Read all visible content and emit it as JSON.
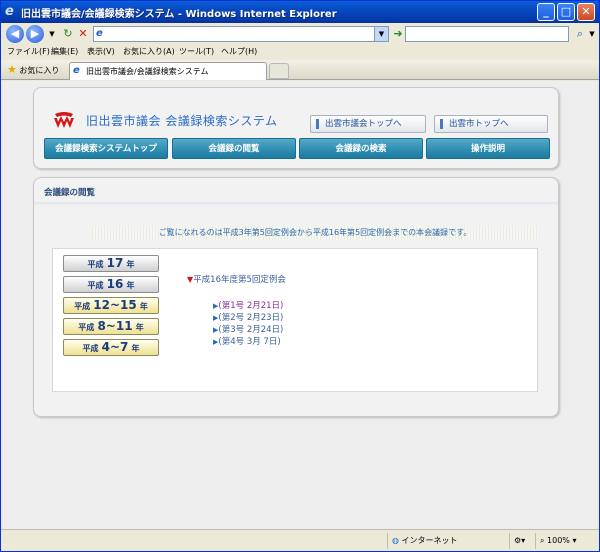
{
  "window": {
    "title": "旧出雲市議会/会議録検索システム - Windows Internet Explorer",
    "minimize": "_",
    "maximize": "□",
    "close": "✕"
  },
  "menu": [
    "ファイル(F)",
    "編集(E)",
    "表示(V)",
    "お気に入り(A)",
    "ツール(T)",
    "ヘルプ(H)"
  ],
  "favorites_label": "お気に入り",
  "tab_label": "旧出雲市議会/会議録検索システム",
  "site": {
    "title": "旧出雲市議会 会議録検索システム",
    "top_links": [
      "出雲市議会トップへ",
      "出雲市トップへ"
    ],
    "nav": [
      "会議録検索システムトップ",
      "会議録の閲覧",
      "会議録の検索",
      "操作説明"
    ]
  },
  "browse": {
    "section_title": "会議録の閲覧",
    "notice": "ご覧になれるのは平成3年第5回定例会から平成16年第5回定例会までの本会議録です。",
    "years": [
      {
        "prefix": "平成",
        "num": "17",
        "suffix": "年",
        "style": "grey"
      },
      {
        "prefix": "平成",
        "num": "16",
        "suffix": "年",
        "style": "grey"
      },
      {
        "prefix": "平成",
        "num": "12~15",
        "suffix": "年",
        "style": "yel"
      },
      {
        "prefix": "平成",
        "num": "8~11",
        "suffix": "年",
        "style": "yel"
      },
      {
        "prefix": "平成",
        "num": "4~7",
        "suffix": "年",
        "style": "yel"
      }
    ],
    "session_title": "平成16年度第5回定例会",
    "session_items": [
      {
        "label": "(第1号 2月21日)",
        "visited": true
      },
      {
        "label": "(第2号 2月23日)",
        "visited": false
      },
      {
        "label": "(第3号 2月24日)",
        "visited": false
      },
      {
        "label": "(第4号 3月 7日)",
        "visited": false
      }
    ]
  },
  "status": {
    "zone": "インターネット",
    "zoom": "100%"
  },
  "colors": {
    "title_bar": "#0a5fd8",
    "nav_tab": "#2f8fb3",
    "accent_red": "#d01818"
  }
}
